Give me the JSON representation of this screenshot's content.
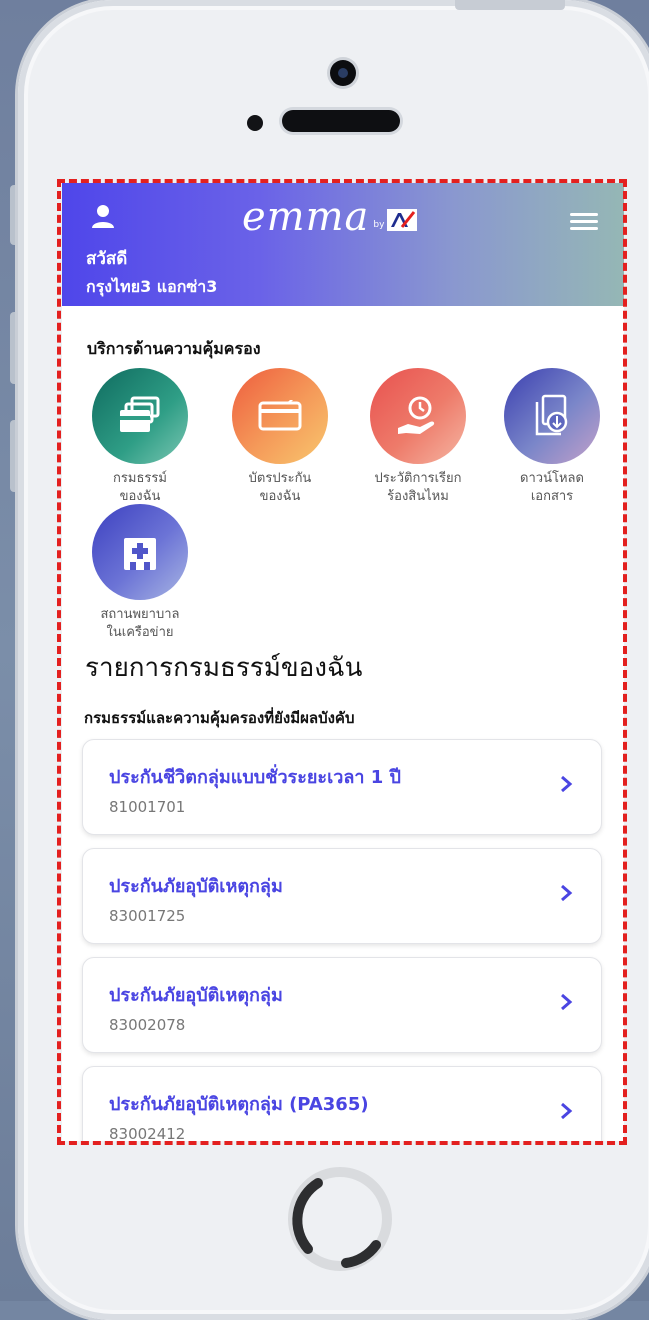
{
  "header": {
    "logo_text": "emma",
    "logo_by": "by",
    "greeting": "สวัสดี",
    "user_name": "กรุงไทย3 แอกซ่า3"
  },
  "services": {
    "title": "บริการด้านความคุ้มครอง",
    "items": [
      {
        "line1": "กรมธรรม์",
        "line2": "ของฉัน",
        "icon": "policy-cards-icon"
      },
      {
        "line1": "บัตรประกัน",
        "line2": "ของฉัน",
        "icon": "insurance-card-icon"
      },
      {
        "line1": "ประวัติการเรียก",
        "line2": "ร้องสินไหม",
        "icon": "claim-history-icon"
      },
      {
        "line1": "ดาวน์โหลด",
        "line2": "เอกสาร",
        "icon": "download-document-icon"
      },
      {
        "line1": "สถานพยาบาล",
        "line2": "ในเครือข่าย",
        "icon": "hospital-icon"
      }
    ]
  },
  "policies": {
    "title": "รายการกรมธรรม์ของฉัน",
    "subtitle": "กรมธรรม์และความคุ้มครองที่ยังมีผลบังคับ",
    "items": [
      {
        "name": "ประกันชีวิตกลุ่มแบบชั่วระยะเวลา 1 ปี",
        "number": "81001701"
      },
      {
        "name": "ประกันภัยอุบัติเหตุกลุ่ม",
        "number": "83001725"
      },
      {
        "name": "ประกันภัยอุบัติเหตุกลุ่ม",
        "number": "83002078"
      },
      {
        "name": "ประกันภัยอุบัติเหตุกลุ่ม (PA365)",
        "number": "83002412"
      }
    ]
  },
  "colors": {
    "accent": "#4a45e2",
    "highlight_border": "#e3201f"
  }
}
